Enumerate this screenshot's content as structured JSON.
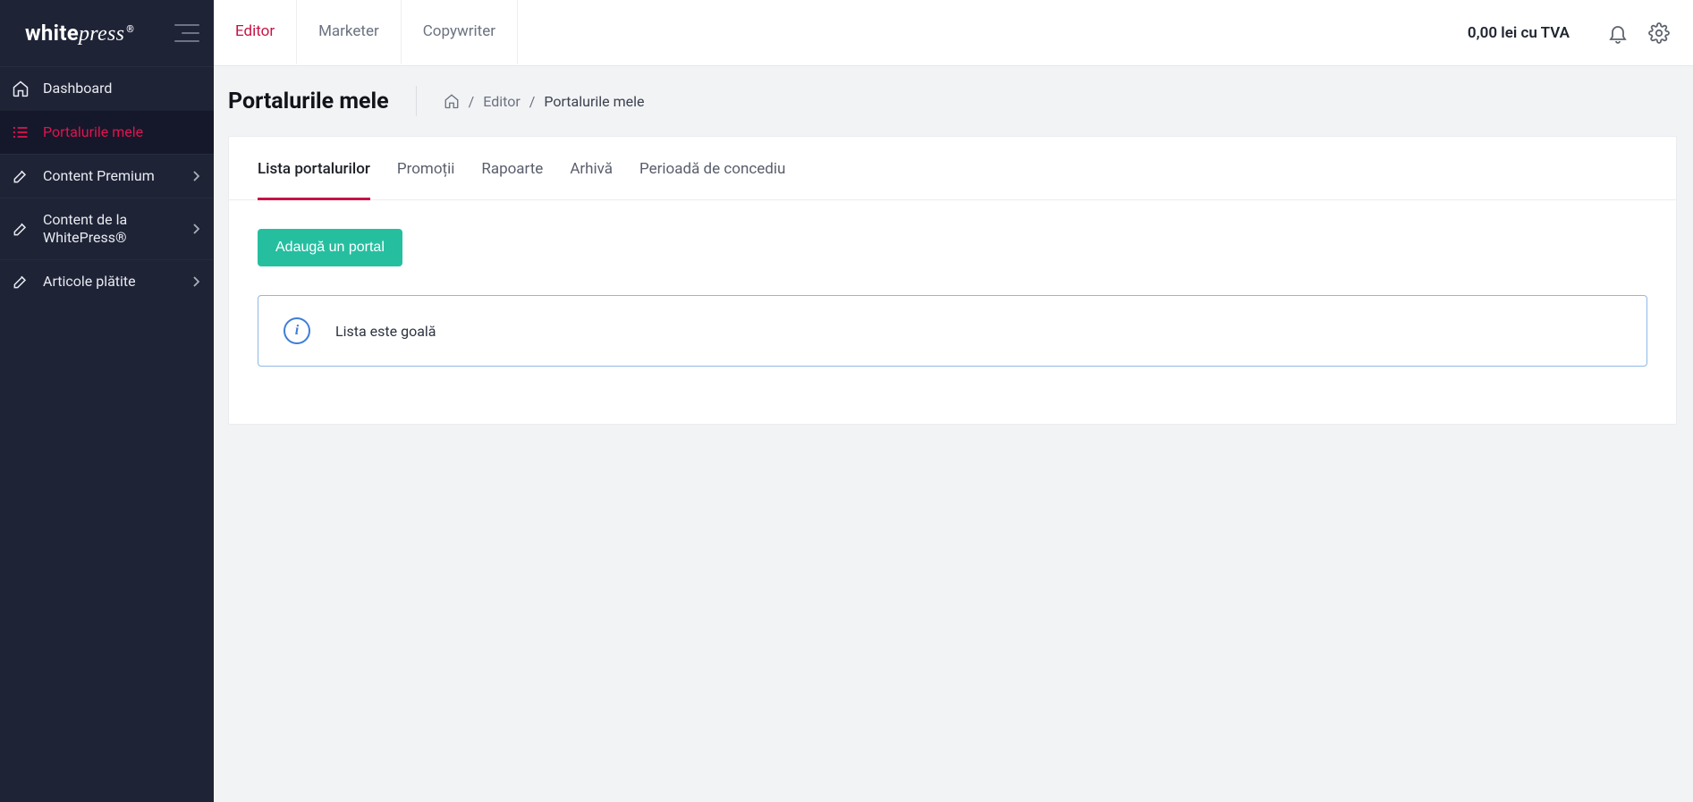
{
  "brand": {
    "part1": "white",
    "part2": "press",
    "reg": "®"
  },
  "sidebar": {
    "items": [
      {
        "label": "Dashboard"
      },
      {
        "label": "Portalurile mele"
      },
      {
        "label": "Content Premium"
      },
      {
        "label": "Content de la WhitePress®"
      },
      {
        "label": "Articole plătite"
      }
    ]
  },
  "topbar": {
    "roles": [
      {
        "label": "Editor"
      },
      {
        "label": "Marketer"
      },
      {
        "label": "Copywriter"
      }
    ],
    "balance": "0,00 lei cu TVA"
  },
  "page": {
    "title": "Portalurile mele",
    "breadcrumb": {
      "editor": "Editor",
      "current": "Portalurile mele"
    }
  },
  "tabs": [
    {
      "label": "Lista portalurilor"
    },
    {
      "label": "Promoții"
    },
    {
      "label": "Rapoarte"
    },
    {
      "label": "Arhivă"
    },
    {
      "label": "Perioadă de concediu"
    }
  ],
  "actions": {
    "add_portal": "Adaugă un portal"
  },
  "banner": {
    "icon_char": "i",
    "text": "Lista este goală"
  }
}
